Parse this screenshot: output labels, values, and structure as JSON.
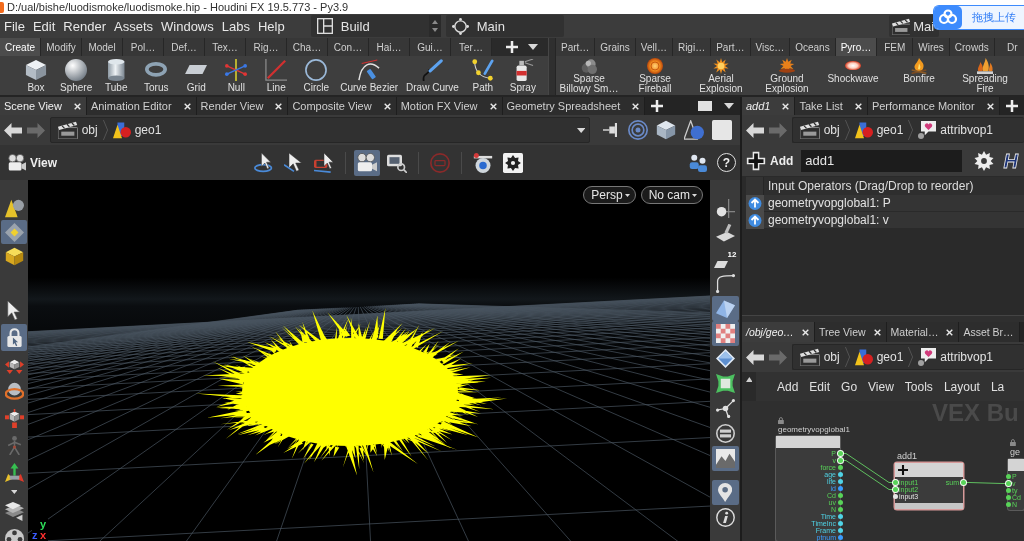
{
  "title_bar": {
    "title": "D:/ual/bishe/luodismoke/luodismoke.hip - Houdini FX 19.5.773 - Py3.9"
  },
  "menu_bar": {
    "items": [
      "File",
      "Edit",
      "Render",
      "Assets",
      "Windows",
      "Labs",
      "Help"
    ],
    "desktop": "Build",
    "context": "Main",
    "take": "Mai"
  },
  "upload_widget": {
    "label": "拖拽上传"
  },
  "shelves": [
    {
      "tabs": [
        {
          "label": "Create",
          "selected": true
        },
        {
          "label": "Modify",
          "selected": false
        },
        {
          "label": "Model",
          "selected": false
        },
        {
          "label": "Pol…",
          "selected": false
        },
        {
          "label": "Def…",
          "selected": false
        },
        {
          "label": "Tex…",
          "selected": false
        },
        {
          "label": "Rig…",
          "selected": false
        },
        {
          "label": "Cha…",
          "selected": false
        },
        {
          "label": "Con…",
          "selected": false
        },
        {
          "label": "Hai…",
          "selected": false
        },
        {
          "label": "Gui…",
          "selected": false
        },
        {
          "label": "Ter…",
          "selected": false
        }
      ],
      "tools": [
        "Box",
        "Sphere",
        "Tube",
        "Torus",
        "Grid",
        "Null",
        "Line",
        "Circle",
        "Curve Bezier",
        "Draw Curve",
        "Path",
        "Spray"
      ]
    },
    {
      "tabs": [
        {
          "label": "Part…",
          "selected": false
        },
        {
          "label": "Grains",
          "selected": false
        },
        {
          "label": "Vell…",
          "selected": false
        },
        {
          "label": "Rigi…",
          "selected": false
        },
        {
          "label": "Part…",
          "selected": false
        },
        {
          "label": "Visc…",
          "selected": false
        },
        {
          "label": "Oceans",
          "selected": false
        },
        {
          "label": "Pyro…",
          "selected": true
        },
        {
          "label": "FEM",
          "selected": false
        },
        {
          "label": "Wires",
          "selected": false
        },
        {
          "label": "Crowds",
          "selected": false
        },
        {
          "label": "Dr",
          "selected": false
        }
      ],
      "tools": [
        "Sparse Billowy Sm…",
        "Sparse Fireball",
        "Aerial Explosion",
        "Ground Explosion",
        "Shockwave",
        "Bonfire",
        "Spreading Fire"
      ]
    }
  ],
  "scene_pane": {
    "tabs": [
      {
        "label": "Scene View",
        "selected": true,
        "dynamic_title": false,
        "close_shown": true
      },
      {
        "label": "Animation Editor",
        "selected": false,
        "dynamic_title": false,
        "close_shown": true
      },
      {
        "label": "Render View",
        "selected": false,
        "dynamic_title": false,
        "close_shown": true
      },
      {
        "label": "Composite View",
        "selected": false,
        "dynamic_title": false,
        "close_shown": true
      },
      {
        "label": "Motion FX View",
        "selected": false,
        "dynamic_title": false,
        "close_shown": true
      },
      {
        "label": "Geometry Spreadsheet",
        "selected": false,
        "dynamic_title": false,
        "close_shown": true
      }
    ],
    "path": [
      "obj",
      "geo1"
    ],
    "viewer": {
      "title": "View",
      "help": "?",
      "tools": [
        {
          "on": false
        },
        {
          "on": false
        },
        {
          "on": false
        },
        {
          "on": true
        },
        {
          "on": false
        },
        {
          "on": false
        },
        {
          "on": false
        },
        {
          "on": false
        }
      ]
    },
    "camera": "Persp",
    "camera_menu": "No cam",
    "left_tools": [
      {
        "on": false
      },
      {
        "on": true
      },
      {
        "on": false
      },
      {
        "on": false
      },
      {
        "on": true
      },
      {
        "on": false
      },
      {
        "on": false
      },
      {
        "on": false
      },
      {
        "on": false
      },
      {
        "on": false
      },
      {
        "on": false
      },
      {
        "on": false
      }
    ],
    "right_tools": [
      {
        "on": false
      },
      {
        "on": false
      },
      {
        "on": false,
        "number": "12"
      },
      {
        "on": false
      },
      {
        "on": true
      },
      {
        "on": true
      },
      {
        "on": false
      },
      {
        "on": false
      },
      {
        "on": false
      },
      {
        "on": false
      },
      {
        "on": true
      },
      {
        "on": true
      },
      {
        "on": false
      }
    ],
    "axis_labels": [
      {
        "label": "y",
        "color": "#2ee05a"
      },
      {
        "label": "z",
        "color": "#3a5cff"
      },
      {
        "label": "x",
        "color": "#ff3030"
      }
    ]
  },
  "parameter_pane": {
    "tabs": [
      {
        "label": "add1",
        "selected": true,
        "dynamic_title": true,
        "close_shown": true
      },
      {
        "label": "Take List",
        "selected": false,
        "dynamic_title": false,
        "close_shown": true
      },
      {
        "label": "Performance Monitor",
        "selected": false,
        "dynamic_title": false,
        "close_shown": true
      }
    ],
    "path": [
      "obj",
      "geo1",
      "attribvop1"
    ],
    "node_type": "Add",
    "node_name": "add1",
    "help": "H",
    "table": {
      "header": "Input Operators (Drag/Drop to reorder)",
      "rows": [
        "geometryvopglobal1: P",
        "geometryvopglobal1: v"
      ]
    }
  },
  "network_pane": {
    "tabs": [
      {
        "label": "/obj/geo…",
        "selected": true,
        "dynamic_title": true,
        "close_shown": true
      },
      {
        "label": "Tree View",
        "selected": false,
        "dynamic_title": false,
        "close_shown": true
      },
      {
        "label": "Material…",
        "selected": false,
        "dynamic_title": false,
        "close_shown": true
      },
      {
        "label": "Asset Br…",
        "selected": false,
        "dynamic_title": false,
        "close_shown": false
      }
    ],
    "path": [
      "obj",
      "geo1",
      "attribvop1"
    ],
    "menu": [
      "Add",
      "Edit",
      "Go",
      "View",
      "Tools",
      "Layout",
      "La"
    ],
    "context_label": "VEX Bu",
    "nodes": [
      {
        "name": "geometryvopglobal1",
        "selected": false,
        "locked": true,
        "outputs": [
          {
            "label": "P",
            "color": "#58d358",
            "connected": true
          },
          {
            "label": "v",
            "color": "#58d358",
            "connected": true
          },
          {
            "label": "force",
            "color": "#58d358",
            "connected": false
          },
          {
            "label": "age",
            "color": "#4fd3e6",
            "connected": false
          },
          {
            "label": "life",
            "color": "#4fd3e6",
            "connected": false
          },
          {
            "label": "id",
            "color": "#3a9cff",
            "connected": false
          },
          {
            "label": "Cd",
            "color": "#58d358",
            "connected": false
          },
          {
            "label": "uv",
            "color": "#58d358",
            "connected": false
          },
          {
            "label": "N",
            "color": "#58d358",
            "connected": false
          },
          {
            "label": "Time",
            "color": "#4fd3e6",
            "connected": false
          },
          {
            "label": "TimeInc",
            "color": "#4fd3e6",
            "connected": false
          },
          {
            "label": "Frame",
            "color": "#4fd3e6",
            "connected": false
          },
          {
            "label": "ptnum",
            "color": "#3a9cff",
            "connected": false
          }
        ]
      },
      {
        "name": "add1",
        "selected": true,
        "locked": false,
        "inputs": [
          {
            "label": "input1",
            "color": "#58d358",
            "connected": true
          },
          {
            "label": "input2",
            "color": "#58d358",
            "connected": true
          },
          {
            "label": "input3",
            "color": "#e6e6e6",
            "connected": false
          }
        ],
        "outputs": [
          {
            "label": "sum",
            "color": "#58d358",
            "connected": true
          }
        ]
      },
      {
        "name": "ge",
        "selected": false,
        "locked": true,
        "inputs": [
          {
            "label": "P",
            "color": "#58d358",
            "connected": false
          },
          {
            "label": "v",
            "color": "#58d358",
            "connected": true
          },
          {
            "label": "ty",
            "color": "#58d358",
            "connected": false
          },
          {
            "label": "Cd",
            "color": "#58d358",
            "connected": false
          },
          {
            "label": "N",
            "color": "#58d358",
            "connected": false
          }
        ]
      }
    ]
  }
}
